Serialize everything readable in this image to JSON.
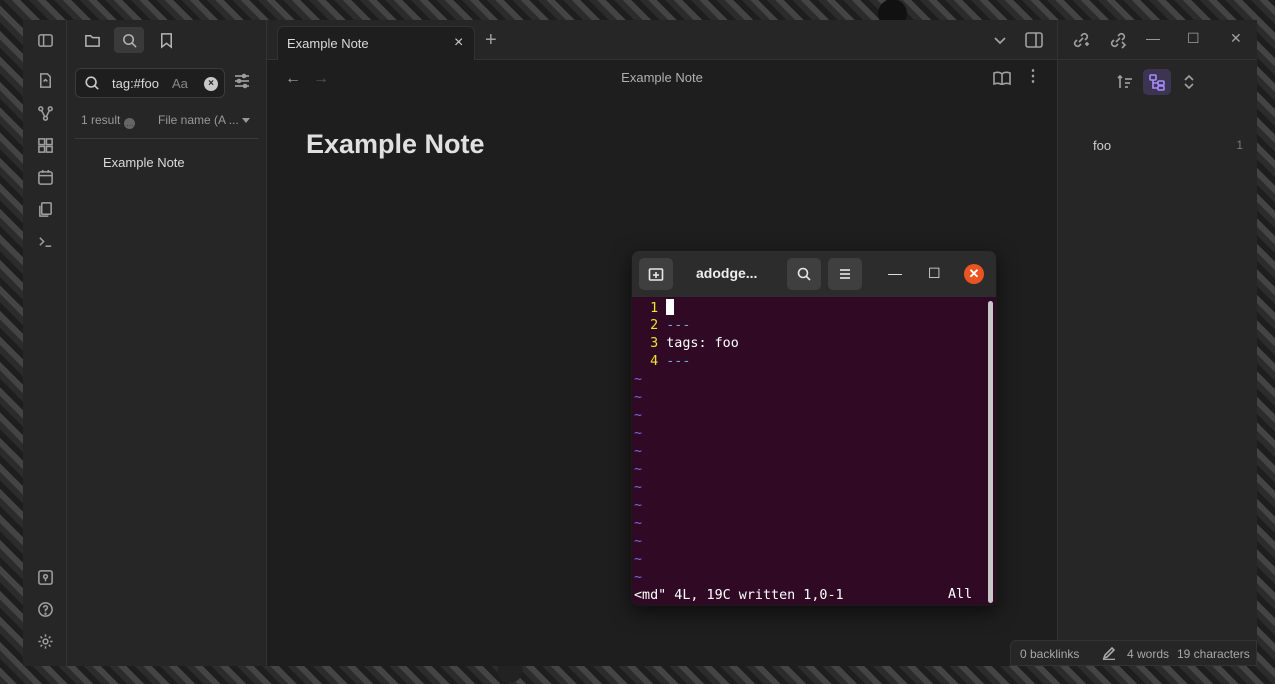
{
  "search": {
    "query": "tag:#foo",
    "match_case_label": "Aa",
    "result_count": "1 result",
    "sort_label": "File name (A ...",
    "results": [
      "Example Note"
    ]
  },
  "tabs": [
    {
      "label": "Example Note",
      "active": true
    }
  ],
  "editor": {
    "view_title": "Example Note",
    "note_title": "Example Note"
  },
  "tags_pane": {
    "tags": [
      {
        "name": "foo",
        "count": "1"
      }
    ]
  },
  "status_bar": {
    "backlinks": "0 backlinks",
    "words": "4 words",
    "characters": "19 characters"
  },
  "terminal": {
    "title": "adodge...",
    "lines": [
      {
        "num": "1",
        "text": ""
      },
      {
        "num": "2",
        "text": "---"
      },
      {
        "num": "3",
        "text": "tags: foo"
      },
      {
        "num": "4",
        "text": "---"
      }
    ],
    "tilde": "~",
    "status_line": "<md\" 4L, 19C written 1,0-1",
    "position": "All",
    "close_glyph": "✕",
    "min_glyph": "—",
    "max_glyph": "☐"
  },
  "glyphs": {
    "tab_close": "×",
    "tab_add": "+",
    "back": "←",
    "forward": "→",
    "more": "⋮",
    "win_min": "—",
    "win_max": "☐",
    "win_close": "✕",
    "clear": "×"
  },
  "colors": {
    "accent": "#a88bfa",
    "terminal_bg": "#300a24",
    "terminal_close": "#e95420",
    "line_number": "#f0e130"
  }
}
